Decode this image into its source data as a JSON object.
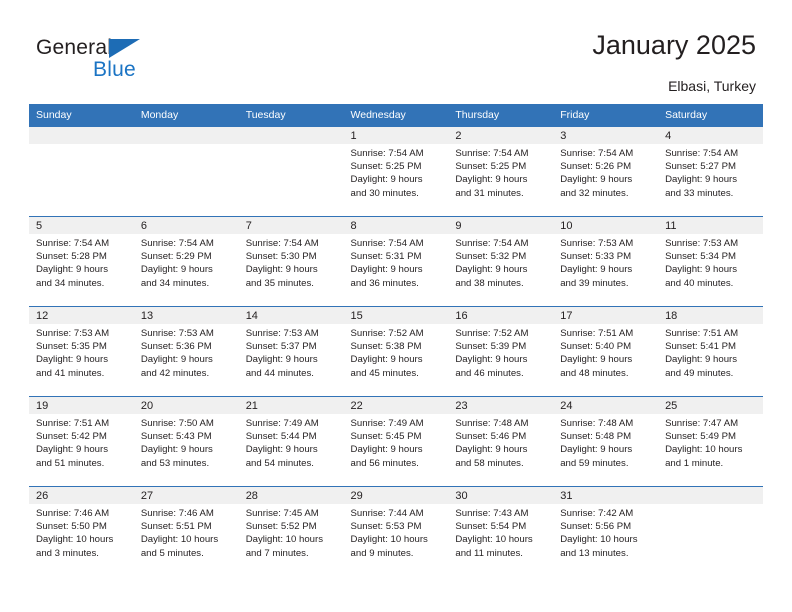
{
  "brand": {
    "name_part1": "General",
    "name_part2": "Blue",
    "triangle_icon": "triangle-icon",
    "accent_color": "#1b74c4"
  },
  "header": {
    "title": "January 2025",
    "subtitle": "Elbasi, Turkey"
  },
  "calendar": {
    "header_bg": "#3273b7",
    "daynum_bg": "#f0f0f0",
    "weekdays": [
      "Sunday",
      "Monday",
      "Tuesday",
      "Wednesday",
      "Thursday",
      "Friday",
      "Saturday"
    ],
    "weeks": [
      [
        {
          "day": "",
          "lines": []
        },
        {
          "day": "",
          "lines": []
        },
        {
          "day": "",
          "lines": []
        },
        {
          "day": "1",
          "lines": [
            "Sunrise: 7:54 AM",
            "Sunset: 5:25 PM",
            "Daylight: 9 hours",
            "and 30 minutes."
          ]
        },
        {
          "day": "2",
          "lines": [
            "Sunrise: 7:54 AM",
            "Sunset: 5:25 PM",
            "Daylight: 9 hours",
            "and 31 minutes."
          ]
        },
        {
          "day": "3",
          "lines": [
            "Sunrise: 7:54 AM",
            "Sunset: 5:26 PM",
            "Daylight: 9 hours",
            "and 32 minutes."
          ]
        },
        {
          "day": "4",
          "lines": [
            "Sunrise: 7:54 AM",
            "Sunset: 5:27 PM",
            "Daylight: 9 hours",
            "and 33 minutes."
          ]
        }
      ],
      [
        {
          "day": "5",
          "lines": [
            "Sunrise: 7:54 AM",
            "Sunset: 5:28 PM",
            "Daylight: 9 hours",
            "and 34 minutes."
          ]
        },
        {
          "day": "6",
          "lines": [
            "Sunrise: 7:54 AM",
            "Sunset: 5:29 PM",
            "Daylight: 9 hours",
            "and 34 minutes."
          ]
        },
        {
          "day": "7",
          "lines": [
            "Sunrise: 7:54 AM",
            "Sunset: 5:30 PM",
            "Daylight: 9 hours",
            "and 35 minutes."
          ]
        },
        {
          "day": "8",
          "lines": [
            "Sunrise: 7:54 AM",
            "Sunset: 5:31 PM",
            "Daylight: 9 hours",
            "and 36 minutes."
          ]
        },
        {
          "day": "9",
          "lines": [
            "Sunrise: 7:54 AM",
            "Sunset: 5:32 PM",
            "Daylight: 9 hours",
            "and 38 minutes."
          ]
        },
        {
          "day": "10",
          "lines": [
            "Sunrise: 7:53 AM",
            "Sunset: 5:33 PM",
            "Daylight: 9 hours",
            "and 39 minutes."
          ]
        },
        {
          "day": "11",
          "lines": [
            "Sunrise: 7:53 AM",
            "Sunset: 5:34 PM",
            "Daylight: 9 hours",
            "and 40 minutes."
          ]
        }
      ],
      [
        {
          "day": "12",
          "lines": [
            "Sunrise: 7:53 AM",
            "Sunset: 5:35 PM",
            "Daylight: 9 hours",
            "and 41 minutes."
          ]
        },
        {
          "day": "13",
          "lines": [
            "Sunrise: 7:53 AM",
            "Sunset: 5:36 PM",
            "Daylight: 9 hours",
            "and 42 minutes."
          ]
        },
        {
          "day": "14",
          "lines": [
            "Sunrise: 7:53 AM",
            "Sunset: 5:37 PM",
            "Daylight: 9 hours",
            "and 44 minutes."
          ]
        },
        {
          "day": "15",
          "lines": [
            "Sunrise: 7:52 AM",
            "Sunset: 5:38 PM",
            "Daylight: 9 hours",
            "and 45 minutes."
          ]
        },
        {
          "day": "16",
          "lines": [
            "Sunrise: 7:52 AM",
            "Sunset: 5:39 PM",
            "Daylight: 9 hours",
            "and 46 minutes."
          ]
        },
        {
          "day": "17",
          "lines": [
            "Sunrise: 7:51 AM",
            "Sunset: 5:40 PM",
            "Daylight: 9 hours",
            "and 48 minutes."
          ]
        },
        {
          "day": "18",
          "lines": [
            "Sunrise: 7:51 AM",
            "Sunset: 5:41 PM",
            "Daylight: 9 hours",
            "and 49 minutes."
          ]
        }
      ],
      [
        {
          "day": "19",
          "lines": [
            "Sunrise: 7:51 AM",
            "Sunset: 5:42 PM",
            "Daylight: 9 hours",
            "and 51 minutes."
          ]
        },
        {
          "day": "20",
          "lines": [
            "Sunrise: 7:50 AM",
            "Sunset: 5:43 PM",
            "Daylight: 9 hours",
            "and 53 minutes."
          ]
        },
        {
          "day": "21",
          "lines": [
            "Sunrise: 7:49 AM",
            "Sunset: 5:44 PM",
            "Daylight: 9 hours",
            "and 54 minutes."
          ]
        },
        {
          "day": "22",
          "lines": [
            "Sunrise: 7:49 AM",
            "Sunset: 5:45 PM",
            "Daylight: 9 hours",
            "and 56 minutes."
          ]
        },
        {
          "day": "23",
          "lines": [
            "Sunrise: 7:48 AM",
            "Sunset: 5:46 PM",
            "Daylight: 9 hours",
            "and 58 minutes."
          ]
        },
        {
          "day": "24",
          "lines": [
            "Sunrise: 7:48 AM",
            "Sunset: 5:48 PM",
            "Daylight: 9 hours",
            "and 59 minutes."
          ]
        },
        {
          "day": "25",
          "lines": [
            "Sunrise: 7:47 AM",
            "Sunset: 5:49 PM",
            "Daylight: 10 hours",
            "and 1 minute."
          ]
        }
      ],
      [
        {
          "day": "26",
          "lines": [
            "Sunrise: 7:46 AM",
            "Sunset: 5:50 PM",
            "Daylight: 10 hours",
            "and 3 minutes."
          ]
        },
        {
          "day": "27",
          "lines": [
            "Sunrise: 7:46 AM",
            "Sunset: 5:51 PM",
            "Daylight: 10 hours",
            "and 5 minutes."
          ]
        },
        {
          "day": "28",
          "lines": [
            "Sunrise: 7:45 AM",
            "Sunset: 5:52 PM",
            "Daylight: 10 hours",
            "and 7 minutes."
          ]
        },
        {
          "day": "29",
          "lines": [
            "Sunrise: 7:44 AM",
            "Sunset: 5:53 PM",
            "Daylight: 10 hours",
            "and 9 minutes."
          ]
        },
        {
          "day": "30",
          "lines": [
            "Sunrise: 7:43 AM",
            "Sunset: 5:54 PM",
            "Daylight: 10 hours",
            "and 11 minutes."
          ]
        },
        {
          "day": "31",
          "lines": [
            "Sunrise: 7:42 AM",
            "Sunset: 5:56 PM",
            "Daylight: 10 hours",
            "and 13 minutes."
          ]
        },
        {
          "day": "",
          "lines": []
        }
      ]
    ]
  }
}
